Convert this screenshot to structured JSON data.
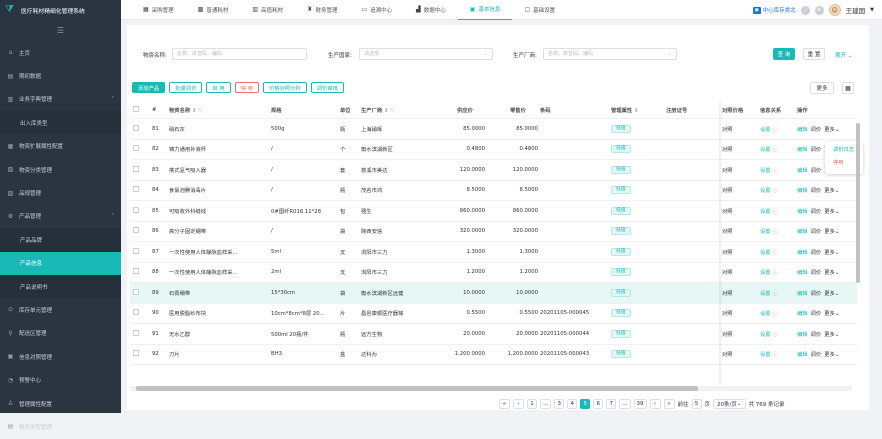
{
  "app": {
    "title": "医疗耗材精细化管理系统"
  },
  "sidebar": {
    "items": [
      {
        "label": "主页",
        "icon": "home-icon",
        "glyph": "⌂"
      },
      {
        "label": "期初数据",
        "icon": "ledger-icon",
        "glyph": "▤"
      },
      {
        "label": "业务字典管理",
        "icon": "dictionary-icon",
        "glyph": "▥",
        "chev": "⌃"
      },
      {
        "label": "出入库类型",
        "sub": true
      },
      {
        "label": "物资扩展属性配置",
        "icon": "config-icon",
        "glyph": "▦"
      },
      {
        "label": "物资分类管理",
        "icon": "category-icon",
        "glyph": "▧"
      },
      {
        "label": "品规管理",
        "icon": "spec-icon",
        "glyph": "▨"
      },
      {
        "label": "产品管理",
        "icon": "product-icon",
        "glyph": "⚙",
        "chev": "⌃"
      },
      {
        "label": "产品品牌",
        "sub": true
      },
      {
        "label": "产品信息",
        "sub": true,
        "active": true
      },
      {
        "label": "产品说明书",
        "sub": true
      },
      {
        "label": "库存单元管理",
        "icon": "stock-icon",
        "glyph": "⊙"
      },
      {
        "label": "配送区管理",
        "icon": "delivery-icon",
        "glyph": "⚲"
      },
      {
        "label": "信息对照管理",
        "icon": "compare-icon",
        "glyph": "▣"
      },
      {
        "label": "预警中心",
        "icon": "alert-icon",
        "glyph": "◔"
      },
      {
        "label": "管理属性配置",
        "icon": "attr-icon",
        "glyph": "♙"
      },
      {
        "label": "物资类型管理",
        "icon": "type-icon",
        "glyph": "▤"
      }
    ]
  },
  "topnav": {
    "tabs": [
      {
        "label": "采购管理",
        "icon": "cart-icon",
        "glyph": "▦"
      },
      {
        "label": "普通耗材",
        "icon": "consumable-icon",
        "glyph": "▩"
      },
      {
        "label": "高值耗材",
        "icon": "high-value-icon",
        "glyph": "▥"
      },
      {
        "label": "财务管理",
        "icon": "finance-icon",
        "glyph": "♜"
      },
      {
        "label": "追溯中心",
        "icon": "trace-icon",
        "glyph": "▭"
      },
      {
        "label": "数据中心",
        "icon": "data-icon",
        "glyph": "▟"
      },
      {
        "label": "基本信息",
        "icon": "info-icon",
        "glyph": "▣",
        "active": true
      },
      {
        "label": "基础设置",
        "icon": "settings-icon",
        "glyph": "▢"
      }
    ],
    "center": "中心库存类北",
    "user": "王建国"
  },
  "filter": {
    "name_label": "物资名称:",
    "name_placeholder": "名称、拼音码、编码",
    "country_label": "生产国家:",
    "country_placeholder": "请选择",
    "maker_label": "生产厂商:",
    "maker_placeholder": "名称、拼音码、编码",
    "query": "查 询",
    "reset": "重 置",
    "expand": "展开"
  },
  "actions": [
    "添加产品",
    "批量调价",
    "启 用",
    "停 用",
    "价格对照分析",
    "调价审核"
  ],
  "toolbar": {
    "more": "更多",
    "grid_glyph": "▦"
  },
  "table": {
    "headers": {
      "no": "#",
      "name": "物资名称",
      "spec": "规格",
      "unit": "单位",
      "maker": "生产厂商",
      "supply": "供应价",
      "retail": "零售价",
      "code": "条码",
      "attr": "管理属性",
      "reg": "注册证号",
      "compare": "对照价格",
      "relation": "信息关系",
      "op": "操作"
    },
    "rows": [
      {
        "no": "81",
        "name": "硝石灰",
        "spec": "500g",
        "unit": "瓶",
        "maker": "上海硝晖",
        "supply": "85.0000",
        "retail": "85.0000",
        "code": "",
        "attr": "低值"
      },
      {
        "no": "82",
        "name": "锦力通用补液杯",
        "spec": "/",
        "unit": "个",
        "maker": "衡水滨湖新区",
        "supply": "0.4800",
        "retail": "0.4800",
        "code": "",
        "attr": "低值"
      },
      {
        "no": "83",
        "name": "携式氢气吸入器",
        "spec": "/",
        "unit": "套",
        "maker": "慈溪市美达",
        "supply": "120.0000",
        "retail": "120.0000",
        "code": "",
        "attr": "低值"
      },
      {
        "no": "84",
        "name": "食氯泡腾消毒片",
        "spec": "/",
        "unit": "瓶",
        "maker": "茂名市鸿",
        "supply": "8.5000",
        "retail": "8.5000",
        "code": "",
        "attr": "低值"
      },
      {
        "no": "85",
        "name": "可吸收外科缝线",
        "spec": "0#国纤R016 11*28",
        "unit": "包",
        "maker": "强生",
        "supply": "860.0000",
        "retail": "860.0000",
        "code": "",
        "attr": "低值"
      },
      {
        "no": "86",
        "name": "高分子固定绷带",
        "spec": "/",
        "unit": "袋",
        "maker": "陕西安信",
        "supply": "320.0000",
        "retail": "320.0000",
        "code": "",
        "attr": "低值"
      },
      {
        "no": "87",
        "name": "一次性使用人体静脉血样采...",
        "spec": "5ml",
        "unit": "支",
        "maker": "浏阳市三力",
        "supply": "1.3000",
        "retail": "1.3000",
        "code": "",
        "attr": "低值"
      },
      {
        "no": "88",
        "name": "一次性使用人体静脉血样采...",
        "spec": "2ml",
        "unit": "支",
        "maker": "浏阳市三力",
        "supply": "1.2000",
        "retail": "1.2000",
        "code": "",
        "attr": "低值"
      },
      {
        "no": "89",
        "name": "石膏绷带",
        "spec": "15*30cm",
        "unit": "袋",
        "maker": "衡水滨湖新区远健",
        "supply": "10.0000",
        "retail": "10.0000",
        "code": "",
        "attr": "低值",
        "hl": true
      },
      {
        "no": "90",
        "name": "医用脱脂纱布块",
        "spec": "10cm*8cm*8层 20...",
        "unit": "片",
        "maker": "昌邑康顺医疗器械",
        "supply": "0.5500",
        "retail": "0.5500",
        "code": "20201105-000045",
        "attr": "低值"
      },
      {
        "no": "91",
        "name": "无水乙醇",
        "spec": "500ml 20瓶/件",
        "unit": "瓶",
        "maker": "远方生物",
        "supply": "20.0000",
        "retail": "20.0000",
        "code": "20201105-000044",
        "attr": "低值"
      },
      {
        "no": "92",
        "name": "刀片",
        "spec": "BH3",
        "unit": "盒",
        "maker": "达科为",
        "supply": "1,200.0000",
        "retail": "1,200.0000",
        "code": "20201105-000043",
        "attr": "低值"
      }
    ],
    "row_actions": {
      "compare": "对照",
      "set": "设置",
      "edit": "编辑",
      "price": "调价",
      "more": "更多"
    }
  },
  "popup": {
    "items": [
      "调价日志",
      "停用"
    ]
  },
  "pager": {
    "pages": [
      "1",
      "...",
      "3",
      "4",
      "5",
      "6",
      "7",
      "...",
      "39"
    ],
    "active": "5",
    "goto": "前往",
    "goto_val": "5",
    "page_unit": "页",
    "size": "20条/页",
    "total": "共 769 条记录"
  },
  "colors": {
    "accent": "#19b9b5",
    "sidebar": "#2b3541",
    "danger": "#f56c6c"
  }
}
